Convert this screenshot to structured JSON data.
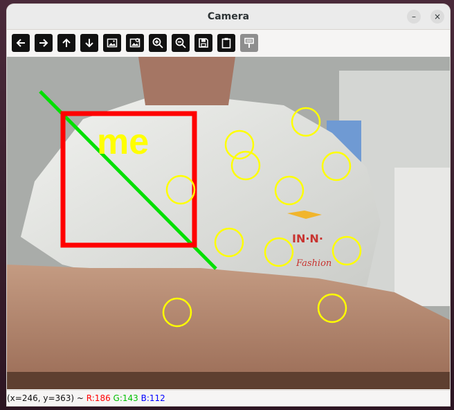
{
  "window": {
    "title": "Camera",
    "minimize_glyph": "–",
    "close_glyph": "×"
  },
  "toolbar": {
    "tools": [
      {
        "name": "arrow-left-icon"
      },
      {
        "name": "arrow-right-icon"
      },
      {
        "name": "arrow-up-icon"
      },
      {
        "name": "arrow-down-icon"
      },
      {
        "name": "image-icon"
      },
      {
        "name": "image-properties-icon"
      },
      {
        "name": "zoom-in-icon"
      },
      {
        "name": "zoom-out-icon"
      },
      {
        "name": "save-icon"
      },
      {
        "name": "clipboard-icon"
      },
      {
        "name": "properties-panel-icon"
      }
    ]
  },
  "overlay": {
    "label_text": "me",
    "colors": {
      "rectangle": "#ff0000",
      "line": "#00e000",
      "circles": "#ffff00",
      "label": "#ffff00"
    }
  },
  "status": {
    "coords": "(x=246, y=363) ~ ",
    "r_label": "R:186",
    "g_label": "G:143",
    "b_label": "B:112",
    "colors": {
      "r": "#ff0000",
      "g": "#00c000",
      "b": "#0000ff"
    }
  }
}
